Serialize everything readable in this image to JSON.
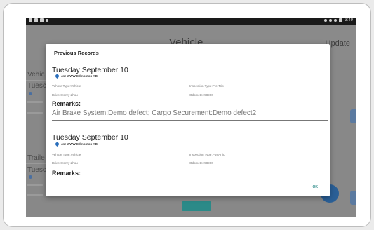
{
  "app": {
    "title": "Vehicle",
    "update_label": "Update"
  },
  "status_bar": {
    "time": "3:49"
  },
  "background": {
    "fragments": [
      "Vehic",
      "Tuesc",
      "Traile",
      "Tuesc"
    ]
  },
  "dialog": {
    "title": "Previous Records",
    "ok_label": "OK",
    "records": [
      {
        "date": "Tuesday September 10",
        "location": "4nt WWW Edmonton AB",
        "vehicle_type": "Vehicle Type:Vehicle",
        "inspection_type": "Inspection Type:Pre-Trip",
        "driver": "Driver:Henry Zhou",
        "odometer": "Odometer:58900",
        "remarks_label": "Remarks:",
        "remarks_text": "Air Brake System:Demo defect; Cargo Securement:Demo defect2"
      },
      {
        "date": "Tuesday September 10",
        "location": "4nt WWW Edmonton AB",
        "vehicle_type": "Vehicle Type:Vehicle",
        "inspection_type": "Inspection Type:Post-Trip",
        "driver": "Driver:Henry Zhou",
        "odometer": "Odometer:58900",
        "remarks_label": "Remarks:",
        "remarks_text": ""
      }
    ]
  },
  "colors": {
    "accent": "#2b8a88",
    "pin": "#2a6ebb",
    "fab": "#2a5f96"
  }
}
